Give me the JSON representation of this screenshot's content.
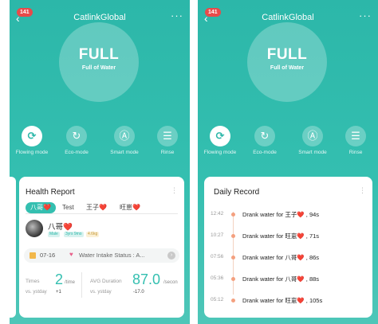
{
  "app": {
    "title": "CatlinkGlobal",
    "badge": "141"
  },
  "status": {
    "main": "FULL",
    "sub": "Full of Water"
  },
  "modes": [
    {
      "label": "Flowing mode",
      "icon": "⟳"
    },
    {
      "label": "Eco-mode",
      "icon": "↻"
    },
    {
      "label": "Smart mode",
      "icon": "Ⓐ"
    },
    {
      "label": "Rinse",
      "icon": "☰"
    }
  ],
  "health_report": {
    "title": "Health Report",
    "tabs": [
      "八哥❤️",
      "Test",
      "王子❤️",
      "旺崽❤️"
    ],
    "pet": {
      "name": "八哥❤️",
      "gender": "Male",
      "age": "3yrs 9mo",
      "weight": "4.6kg"
    },
    "info": {
      "date": "07-16",
      "label": "Water Intake Status : A..."
    },
    "stats": {
      "times_label": "Times",
      "times_value": "2",
      "times_unit": "/time",
      "duration_label": "AVG Duration",
      "duration_value": "87.0",
      "duration_unit": "/secon",
      "vs_label": "vs. ystday",
      "times_delta": "+1",
      "duration_delta": "-17.0"
    }
  },
  "daily_record": {
    "title": "Daily Record",
    "records": [
      {
        "time": "12:42",
        "text": "Drank water for 王子❤️ , 94s"
      },
      {
        "time": "10:27",
        "text": "Drank water for 旺崽❤️ , 71s"
      },
      {
        "time": "07:56",
        "text": "Drank water for 八哥❤️ , 86s"
      },
      {
        "time": "05:36",
        "text": "Drank water for 八哥❤️ , 88s"
      },
      {
        "time": "05:12",
        "text": "Drank water for 旺崽❤️ , 105s"
      }
    ]
  },
  "colors": {
    "accent": "#34bfb0",
    "badge": "#e84a4a",
    "timeline_dot": "#f4a07f"
  }
}
